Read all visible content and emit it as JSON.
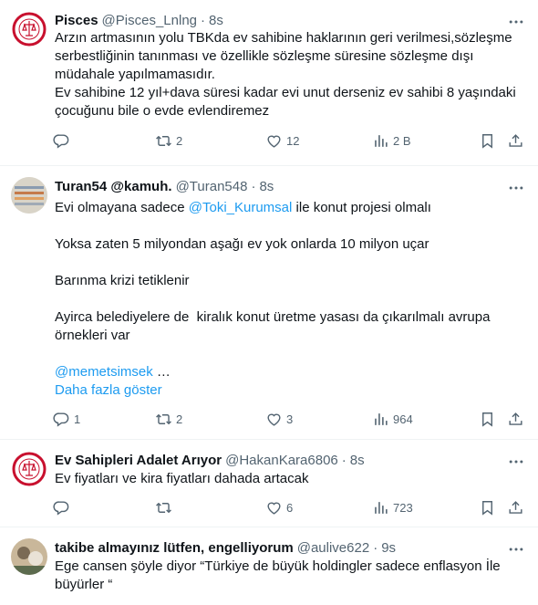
{
  "tweets": [
    {
      "name": "Pisces",
      "handle": "@Pisces_Lnlng",
      "time": "8s",
      "body": "Arzın artmasının yolu TBKda ev sahibine haklarının geri verilmesi,sözleşme serbestliğinin tanınması ve özellikle sözleşme süresine sözleşme dışı müdahale yapılmamasıdır.\nEv sahibine 12 yıl+dava süresi kadar evi unut derseniz ev sahibi 8 yaşındaki çocuğunu bile o evde evlendiremez",
      "replies": "",
      "retweets": "2",
      "likes": "12",
      "views": "2 B"
    },
    {
      "name": "Turan54 @kamuh.",
      "handle": "@Turan548",
      "time": "8s",
      "body_pre": "Evi olmayana sadece ",
      "body_link": "@Toki_Kurumsal",
      "body_post": " ile konut projesi olmalı\n\nYoksa zaten 5 milyondan aşağı ev yok onlarda 10 milyon uçar\n\nBarınma krizi tetiklenir\n\nAyirca belediyelere de  kiralık konut üretme yasası da çıkarılmalı avrupa örnekleri var\n\n",
      "mention": "@memetsimsek",
      "ellipsis": " …",
      "show_more": "Daha fazla göster",
      "replies": "1",
      "retweets": "2",
      "likes": "3",
      "views": "964"
    },
    {
      "name": "Ev Sahipleri Adalet Arıyor",
      "handle": "@HakanKara6806",
      "time": "8s",
      "body": "Ev fiyatları ve kira fiyatları dahada artacak",
      "replies": "",
      "retweets": "",
      "likes": "6",
      "views": "723"
    },
    {
      "name": "takibe almayınız lütfen, engelliyorum",
      "handle": "@aulive622",
      "time": "9s",
      "body": "Ege cansen şöyle diyor “Türkiye de büyük holdingler sadece enflasyon İle büyürler “"
    }
  ],
  "icons": [
    "reply-icon",
    "retweet-icon",
    "like-icon",
    "views-icon",
    "bookmark-icon",
    "share-icon",
    "more-icon"
  ],
  "colors": {
    "text": "#0f1419",
    "secondary": "#536471",
    "link": "#1d9bf0",
    "divider": "#eff3f4"
  },
  "separator": "·"
}
